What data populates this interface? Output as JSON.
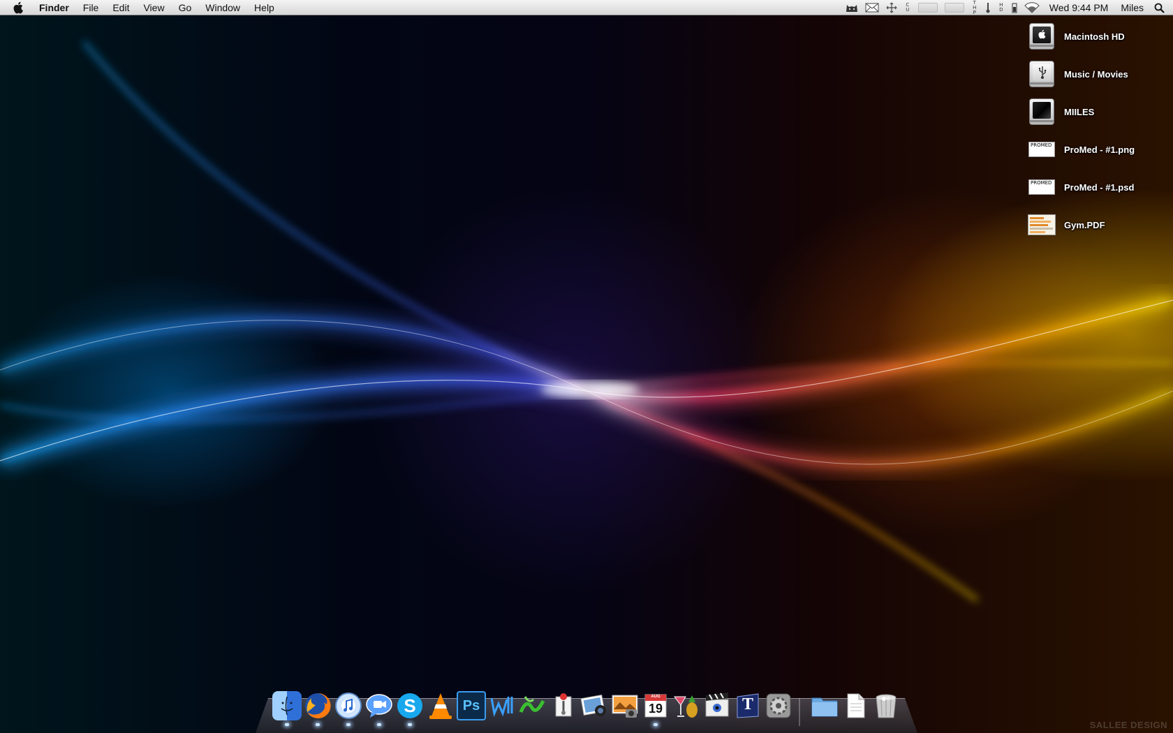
{
  "menubar": {
    "app_name": "Finder",
    "menus": [
      "File",
      "Edit",
      "View",
      "Go",
      "Window",
      "Help"
    ],
    "clock": "Wed 9:44 PM",
    "user": "Miles",
    "status_icons": [
      "cat-menu-icon",
      "mail-icon",
      "move-icon",
      "vertical-text-1",
      "slot-1",
      "slot-2",
      "vertical-text-2",
      "battery-icon",
      "wifi-icon"
    ],
    "stack_text_1": [
      "C",
      "U"
    ],
    "stack_text_2": [
      "T",
      "H",
      "P"
    ],
    "stack_text_3": [
      "H",
      "D"
    ]
  },
  "desktop": {
    "items": [
      {
        "label": "Macintosh HD",
        "icon": "internal-drive-icon"
      },
      {
        "label": "Music / Movies",
        "icon": "usb-drive-icon"
      },
      {
        "label": "MIILES",
        "icon": "external-drive-icon"
      },
      {
        "label": "ProMed - #1.png",
        "icon": "image-thumbnail-icon",
        "thumb_text": "PROMED"
      },
      {
        "label": "ProMed - #1.psd",
        "icon": "psd-thumbnail-icon",
        "thumb_text": "PROMED"
      },
      {
        "label": "Gym.PDF",
        "icon": "pdf-thumbnail-icon"
      }
    ]
  },
  "dock": {
    "apps": [
      {
        "name": "finder-icon",
        "running": true
      },
      {
        "name": "firefox-icon",
        "running": true
      },
      {
        "name": "itunes-icon",
        "running": true
      },
      {
        "name": "ichat-icon",
        "running": true
      },
      {
        "name": "skype-icon",
        "running": true
      },
      {
        "name": "vlc-icon",
        "running": false
      },
      {
        "name": "photoshop-icon",
        "running": false,
        "text": "Ps"
      },
      {
        "name": "wacom-icon",
        "running": false
      },
      {
        "name": "dreamweaver-icon",
        "running": false
      },
      {
        "name": "preview-icon",
        "running": false
      },
      {
        "name": "iphoto-icon",
        "running": false
      },
      {
        "name": "image-capture-icon",
        "running": false
      },
      {
        "name": "ical-icon",
        "running": true,
        "text": "19",
        "month": "AUG"
      },
      {
        "name": "cocktail-icon",
        "running": false
      },
      {
        "name": "imovie-icon",
        "running": false
      },
      {
        "name": "textedit-icon",
        "running": false,
        "text": "T"
      },
      {
        "name": "system-preferences-icon",
        "running": false
      }
    ],
    "stacks": [
      {
        "name": "folder-stack-icon"
      },
      {
        "name": "document-stack-icon"
      },
      {
        "name": "trash-icon"
      }
    ]
  },
  "watermark": "SALLEE DESIGN"
}
